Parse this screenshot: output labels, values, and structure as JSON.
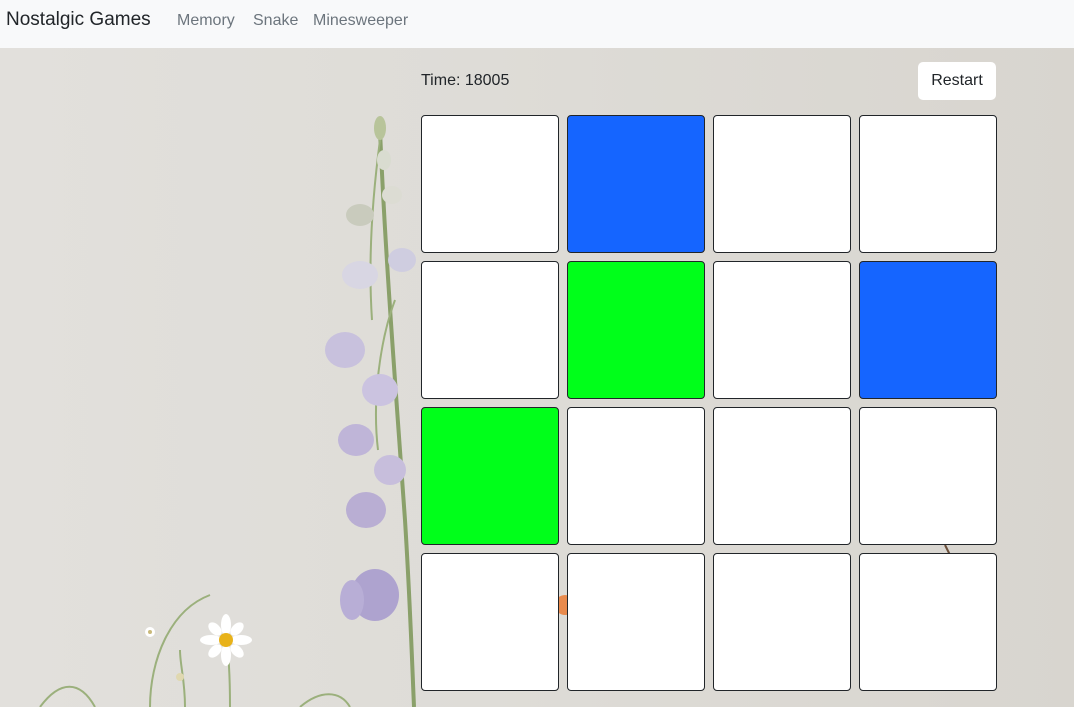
{
  "navbar": {
    "brand": "Nostalgic Games",
    "links": [
      {
        "label": "Memory"
      },
      {
        "label": "Snake"
      },
      {
        "label": "Minesweeper"
      }
    ]
  },
  "game": {
    "timer_text": "Time: 18005",
    "restart_label": "Restart",
    "cards": [
      {
        "state": "hidden",
        "color": "#ffffff"
      },
      {
        "state": "revealed",
        "color": "#1565ff"
      },
      {
        "state": "hidden",
        "color": "#ffffff"
      },
      {
        "state": "hidden",
        "color": "#ffffff"
      },
      {
        "state": "hidden",
        "color": "#ffffff"
      },
      {
        "state": "revealed",
        "color": "#00ff1a"
      },
      {
        "state": "hidden",
        "color": "#ffffff"
      },
      {
        "state": "revealed",
        "color": "#1565ff"
      },
      {
        "state": "revealed",
        "color": "#00ff1a"
      },
      {
        "state": "hidden",
        "color": "#ffffff"
      },
      {
        "state": "hidden",
        "color": "#ffffff"
      },
      {
        "state": "hidden",
        "color": "#ffffff"
      },
      {
        "state": "hidden",
        "color": "#ffffff"
      },
      {
        "state": "hidden",
        "color": "#ffffff"
      },
      {
        "state": "hidden",
        "color": "#ffffff"
      },
      {
        "state": "hidden",
        "color": "#ffffff"
      }
    ]
  }
}
